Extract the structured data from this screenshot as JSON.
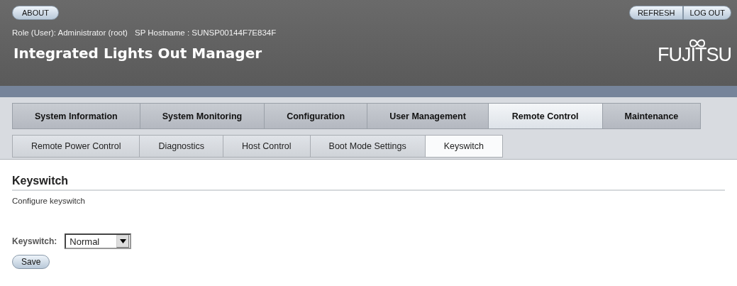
{
  "header": {
    "about_button": "ABOUT",
    "refresh_button": "REFRESH",
    "logout_button": "LOG OUT",
    "role": "Role (User): Administrator (root)",
    "hostname": "SP Hostname : SUNSP00144F7E834F",
    "title": "Integrated Lights Out Manager",
    "logo": "FUJITSU"
  },
  "tabs": [
    {
      "label": "System Information",
      "selected": false
    },
    {
      "label": "System Monitoring",
      "selected": false
    },
    {
      "label": "Configuration",
      "selected": false
    },
    {
      "label": "User Management",
      "selected": false
    },
    {
      "label": "Remote Control",
      "selected": true
    },
    {
      "label": "Maintenance",
      "selected": false
    }
  ],
  "subtabs": [
    {
      "label": "Remote Power Control",
      "selected": false
    },
    {
      "label": "Diagnostics",
      "selected": false
    },
    {
      "label": "Host Control",
      "selected": false
    },
    {
      "label": "Boot Mode Settings",
      "selected": false
    },
    {
      "label": "Keyswitch",
      "selected": true
    }
  ],
  "page": {
    "heading": "Keyswitch",
    "description": "Configure keyswitch",
    "field_label": "Keyswitch:",
    "field_value": "Normal",
    "save_button": "Save"
  }
}
